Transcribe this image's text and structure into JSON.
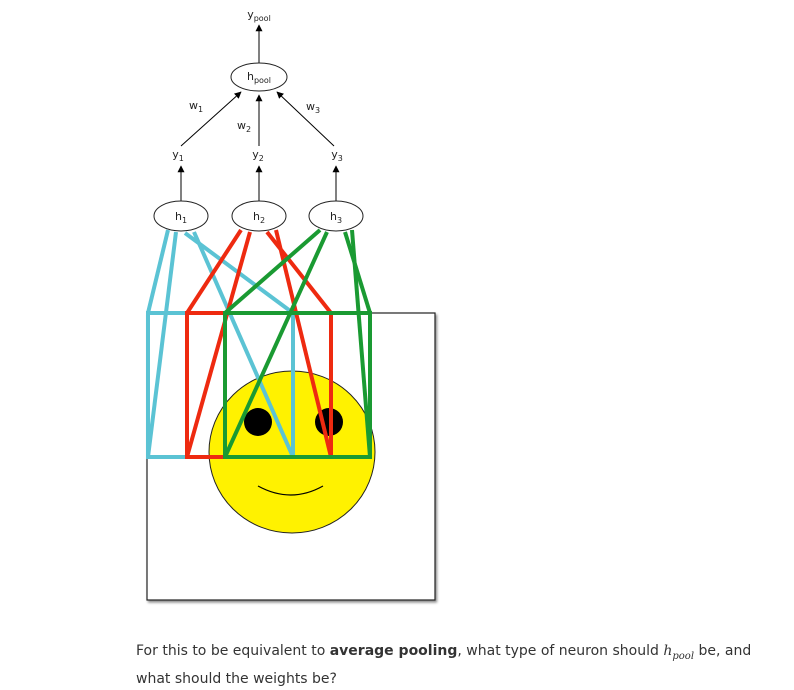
{
  "diagram": {
    "output": {
      "label": "y",
      "sub": "pool"
    },
    "pool_node": {
      "label": "h",
      "sub": "pool"
    },
    "weights": [
      {
        "label": "w",
        "sub": "1"
      },
      {
        "label": "w",
        "sub": "2"
      },
      {
        "label": "w",
        "sub": "3"
      }
    ],
    "outputs": [
      {
        "label": "y",
        "sub": "1"
      },
      {
        "label": "y",
        "sub": "2"
      },
      {
        "label": "y",
        "sub": "3"
      }
    ],
    "hidden": [
      {
        "label": "h",
        "sub": "1"
      },
      {
        "label": "h",
        "sub": "2"
      },
      {
        "label": "h",
        "sub": "3"
      }
    ],
    "colors": {
      "h1_receptive_field": "#5bc3d4",
      "h2_receptive_field": "#ee2a10",
      "h3_receptive_field": "#1a9a32",
      "face_fill": "#fff200",
      "eyes": "#000000"
    }
  },
  "caption": {
    "before": "For this to be equivalent to ",
    "bold": "average pooling",
    "middle": ", what type of neuron should ",
    "math_main": "h",
    "math_sub": "pool",
    "after": " be, and what should the weights be?"
  }
}
